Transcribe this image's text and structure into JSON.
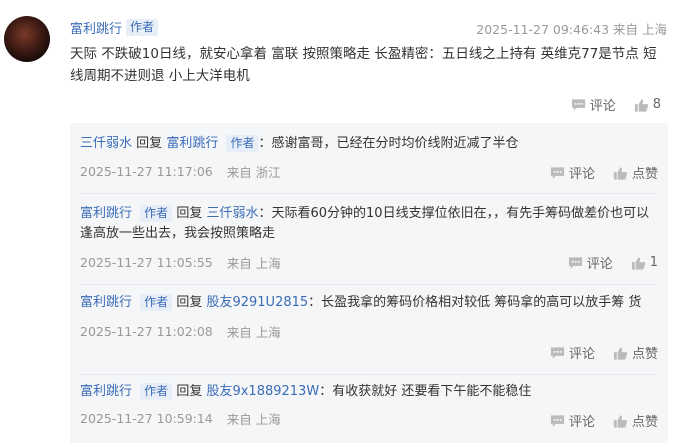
{
  "main": {
    "author": "富利跳行",
    "author_tag": "作者",
    "time": "2025-11-27 09:46:43",
    "location": "来自 上海",
    "text": "天际 不跌破10日线，就安心拿着 富联 按照策略走 长盈精密：五日线之上持有 英维克77是节点 短线周期不进则退 小上大洋电机",
    "comment_label": "评论",
    "like_count": "8"
  },
  "replies": [
    {
      "user": "三仟弱水",
      "reply_word": "回复",
      "target": "富利跳行",
      "target_tag": "作者",
      "text": "：感谢富哥，已经在分时均价线附近减了半仓",
      "time": "2025-11-27 11:17:06",
      "location": "来自 浙江",
      "comment_label": "评论",
      "like_label": "点赞"
    },
    {
      "user": "富利跳行",
      "user_tag": "作者",
      "reply_word": "回复",
      "target": "三仟弱水",
      "text": "：天际看60分钟的10日线支撑位依旧在，，有先手筹码做差价也可以逢高放一些出去，我会按照策略走",
      "time": "2025-11-27 11:05:55",
      "location": "来自 上海",
      "comment_label": "评论",
      "like_label": "1"
    },
    {
      "user": "富利跳行",
      "user_tag": "作者",
      "reply_word": "回复",
      "target": "股友9291U2815",
      "text": "：长盈我拿的筹码价格相对较低 筹码拿的高可以放手筹 货",
      "time": "2025-11-27 11:02:08",
      "location": "来自 上海",
      "comment_label": "评论",
      "like_label": "点赞"
    },
    {
      "user": "富利跳行",
      "user_tag": "作者",
      "reply_word": "回复",
      "target": "股友9x1889213W",
      "text": "：有收获就好 还要看下午能不能稳住",
      "time": "2025-11-27 10:59:14",
      "location": "来自 上海",
      "comment_label": "评论",
      "like_label": "点赞"
    }
  ]
}
